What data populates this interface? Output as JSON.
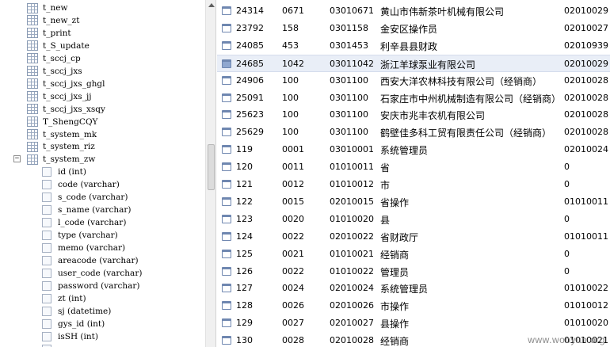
{
  "tree": {
    "nodes": [
      {
        "label": "t_new",
        "kind": "table",
        "level": 0
      },
      {
        "label": "t_new_zt",
        "kind": "table",
        "level": 0
      },
      {
        "label": "t_print",
        "kind": "table",
        "level": 0
      },
      {
        "label": "t_S_update",
        "kind": "table",
        "level": 0
      },
      {
        "label": "t_sccj_cp",
        "kind": "table",
        "level": 0
      },
      {
        "label": "t_sccj_jxs",
        "kind": "table",
        "level": 0
      },
      {
        "label": "t_sccj_jxs_ghgl",
        "kind": "table",
        "level": 0
      },
      {
        "label": "t_sccj_jxs_jj",
        "kind": "table",
        "level": 0
      },
      {
        "label": "t_sccj_jxs_xsqy",
        "kind": "table",
        "level": 0
      },
      {
        "label": "T_ShengCQY",
        "kind": "table",
        "level": 0
      },
      {
        "label": "t_system_mk",
        "kind": "table",
        "level": 0
      },
      {
        "label": "t_system_riz",
        "kind": "table",
        "level": 0
      },
      {
        "label": "t_system_zw",
        "kind": "table",
        "level": 0,
        "expanded": true
      },
      {
        "label": "id (int)",
        "kind": "column",
        "level": 1
      },
      {
        "label": "code (varchar)",
        "kind": "column",
        "level": 1
      },
      {
        "label": "s_code (varchar)",
        "kind": "column",
        "level": 1
      },
      {
        "label": "s_name (varchar)",
        "kind": "column",
        "level": 1
      },
      {
        "label": "l_code (varchar)",
        "kind": "column",
        "level": 1
      },
      {
        "label": "type (varchar)",
        "kind": "column",
        "level": 1
      },
      {
        "label": "memo (varchar)",
        "kind": "column",
        "level": 1
      },
      {
        "label": "areacode (varchar)",
        "kind": "column",
        "level": 1
      },
      {
        "label": "user_code (varchar)",
        "kind": "column",
        "level": 1
      },
      {
        "label": "password (varchar)",
        "kind": "column",
        "level": 1
      },
      {
        "label": "zt (int)",
        "kind": "column",
        "level": 1
      },
      {
        "label": "sj (datetime)",
        "kind": "column",
        "level": 1
      },
      {
        "label": "gys_id (int)",
        "kind": "column",
        "level": 1
      },
      {
        "label": "isSH (int)",
        "kind": "column",
        "level": 1
      },
      {
        "label": "",
        "kind": "column",
        "level": 1
      }
    ],
    "expander_symbol": "−"
  },
  "grid": {
    "rows": [
      {
        "id": "24314",
        "code": "0671",
        "s_code": "03010671",
        "s_name": "黄山市伟新茶叶机械有限公司",
        "l_code": "02010029",
        "selected": false
      },
      {
        "id": "23792",
        "code": "158",
        "s_code": "0301158",
        "s_name": "金安区操作员",
        "l_code": "02010027",
        "selected": false
      },
      {
        "id": "24085",
        "code": "453",
        "s_code": "0301453",
        "s_name": "利辛县县财政",
        "l_code": "02010939",
        "selected": false
      },
      {
        "id": "24685",
        "code": "1042",
        "s_code": "03011042",
        "s_name": "浙江羊球泵业有限公司",
        "l_code": "02010029",
        "selected": true
      },
      {
        "id": "24906",
        "code": "100",
        "s_code": "0301100",
        "s_name": "西安大洋农林科技有限公司（经销商）",
        "l_code": "02010028",
        "selected": false
      },
      {
        "id": "25091",
        "code": "100",
        "s_code": "0301100",
        "s_name": "石家庄市中州机械制造有限公司（经销商）",
        "l_code": "02010028",
        "selected": false
      },
      {
        "id": "25623",
        "code": "100",
        "s_code": "0301100",
        "s_name": "安庆市兆丰农机有限公司",
        "l_code": "02010028",
        "selected": false
      },
      {
        "id": "25629",
        "code": "100",
        "s_code": "0301100",
        "s_name": "鹤壁佳多科工贸有限责任公司（经销商）",
        "l_code": "02010028",
        "selected": false
      },
      {
        "id": "119",
        "code": "0001",
        "s_code": "03010001",
        "s_name": "系统管理员",
        "l_code": "02010024",
        "selected": false
      },
      {
        "id": "120",
        "code": "0011",
        "s_code": "01010011",
        "s_name": "省",
        "l_code": "0",
        "selected": false
      },
      {
        "id": "121",
        "code": "0012",
        "s_code": "01010012",
        "s_name": "市",
        "l_code": "0",
        "selected": false
      },
      {
        "id": "122",
        "code": "0015",
        "s_code": "02010015",
        "s_name": "省操作",
        "l_code": "01010011",
        "selected": false
      },
      {
        "id": "123",
        "code": "0020",
        "s_code": "01010020",
        "s_name": "县",
        "l_code": "0",
        "selected": false
      },
      {
        "id": "124",
        "code": "0022",
        "s_code": "02010022",
        "s_name": "省财政厅",
        "l_code": "01010011",
        "selected": false
      },
      {
        "id": "125",
        "code": "0021",
        "s_code": "01010021",
        "s_name": "经销商",
        "l_code": "0",
        "selected": false
      },
      {
        "id": "126",
        "code": "0022",
        "s_code": "01010022",
        "s_name": "管理员",
        "l_code": "0",
        "selected": false
      },
      {
        "id": "127",
        "code": "0024",
        "s_code": "02010024",
        "s_name": "系统管理员",
        "l_code": "01010022",
        "selected": false
      },
      {
        "id": "128",
        "code": "0026",
        "s_code": "02010026",
        "s_name": "市操作",
        "l_code": "01010012",
        "selected": false
      },
      {
        "id": "129",
        "code": "0027",
        "s_code": "02010027",
        "s_name": "县操作",
        "l_code": "01010020",
        "selected": false
      },
      {
        "id": "130",
        "code": "0028",
        "s_code": "02010028",
        "s_name": "经销商",
        "l_code": "01010021",
        "selected": false
      }
    ]
  },
  "watermark": "www.wooyun.org",
  "colors": {
    "selected_row": "#e9eef7",
    "icon_border": "#6f87b0"
  }
}
